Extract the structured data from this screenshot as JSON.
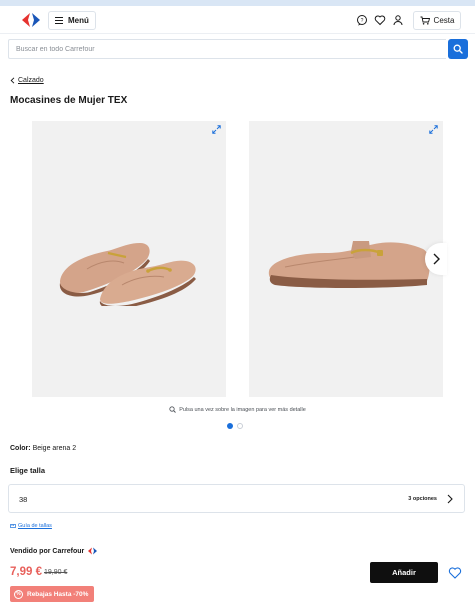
{
  "header": {
    "menu_label": "Menú",
    "cart_label": "Cesta",
    "icons": [
      "carrefour-logo",
      "support-chat-icon",
      "heart-icon",
      "user-icon",
      "cart-icon"
    ]
  },
  "search": {
    "placeholder": "Buscar en todo Carrefour",
    "icon": "search-icon"
  },
  "breadcrumb": {
    "label": "Calzado"
  },
  "product": {
    "title": "Mocasines de Mujer TEX",
    "zoom_hint": "Pulsa una vez sobre la imagen para ver más detalle",
    "gallery": {
      "image_count": 2,
      "active_index": 0
    },
    "color_label": "Color:",
    "color_value": "Beige arena 2",
    "size_label": "Elige talla",
    "size_value": "38",
    "size_options": "3 opciones",
    "size_guide": "Guía de tallas",
    "seller": "Vendido por Carrefour",
    "price": "7,99 €",
    "old_price": "19,90 €",
    "add_label": "Añadir",
    "promo": "Rebajas Hasta -70%"
  },
  "colors": {
    "accent": "#1a6fdb",
    "sale_red": "#e8605b",
    "promo_bg": "#f28079",
    "shoe_tan": "#d4a48a",
    "image_bg": "#f1f1f1"
  }
}
